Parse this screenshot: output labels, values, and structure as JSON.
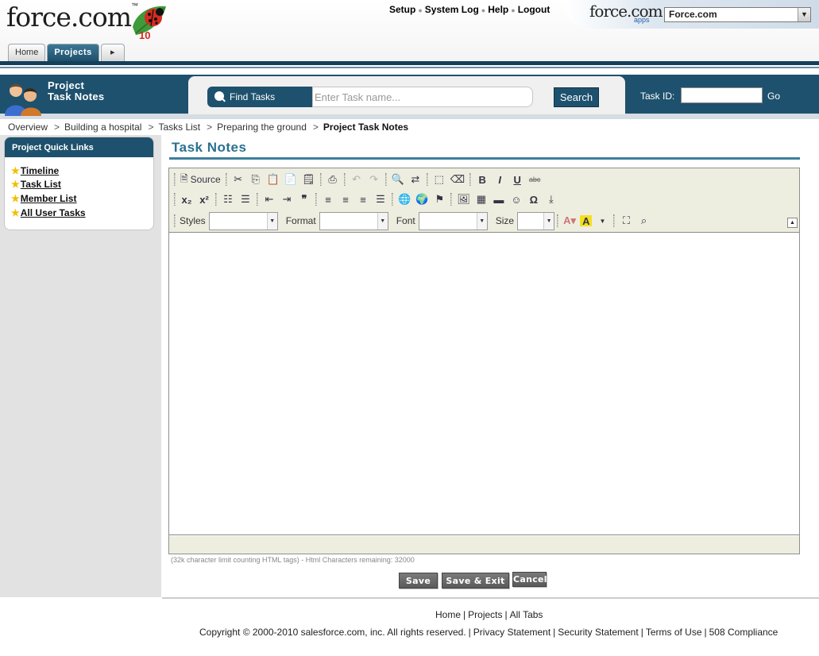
{
  "brand": {
    "logo_text": "force.com",
    "logo_tm": "™",
    "badge": "10"
  },
  "tabs": [
    {
      "label": "Home",
      "active": false
    },
    {
      "label": "Projects",
      "active": true
    }
  ],
  "top_links": [
    "Setup",
    "System Log",
    "Help",
    "Logout"
  ],
  "app_switcher": {
    "logo_text": "force.com",
    "logo_sub": "apps",
    "selected": "Force.com"
  },
  "band": {
    "title_line1": "Project",
    "title_line2": "Task Notes",
    "find_label": "Find Tasks",
    "search_placeholder": "Enter Task name...",
    "search_button": "Search",
    "task_id_label": "Task ID:",
    "task_id_value": "",
    "go_label": "Go"
  },
  "breadcrumb": [
    "Overview",
    "Building a hospital",
    "Tasks List",
    "Preparing the ground",
    "Project Task Notes"
  ],
  "quick_links": {
    "title": "Project Quick Links",
    "items": [
      "Timeline",
      "Task List",
      "Member List",
      "All User Tasks"
    ]
  },
  "page_title": "Task Notes",
  "editor": {
    "source_label": "Source",
    "styles_label": "Styles",
    "format_label": "Format",
    "font_label": "Font",
    "size_label": "Size",
    "styles_value": "",
    "format_value": "",
    "font_value": "",
    "size_value": "",
    "content": ""
  },
  "char_count_text": "(32k character limit counting HTML tags) - Html Characters remaining: 32000",
  "actions": {
    "save": "Save",
    "save_exit": "Save & Exit",
    "cancel": "Cancel"
  },
  "footer": {
    "links": [
      "Home",
      "Projects",
      "All Tabs"
    ],
    "copyright": "Copyright © 2000-2010 salesforce.com, inc. All rights reserved.",
    "legal_links": [
      "Privacy Statement",
      "Security Statement",
      "Terms of Use",
      "508 Compliance"
    ]
  },
  "colors": {
    "brand_blue": "#1e516d",
    "title_teal": "#2a7190",
    "toolbar_bg": "#eeeee0",
    "star": "#f0c000"
  }
}
